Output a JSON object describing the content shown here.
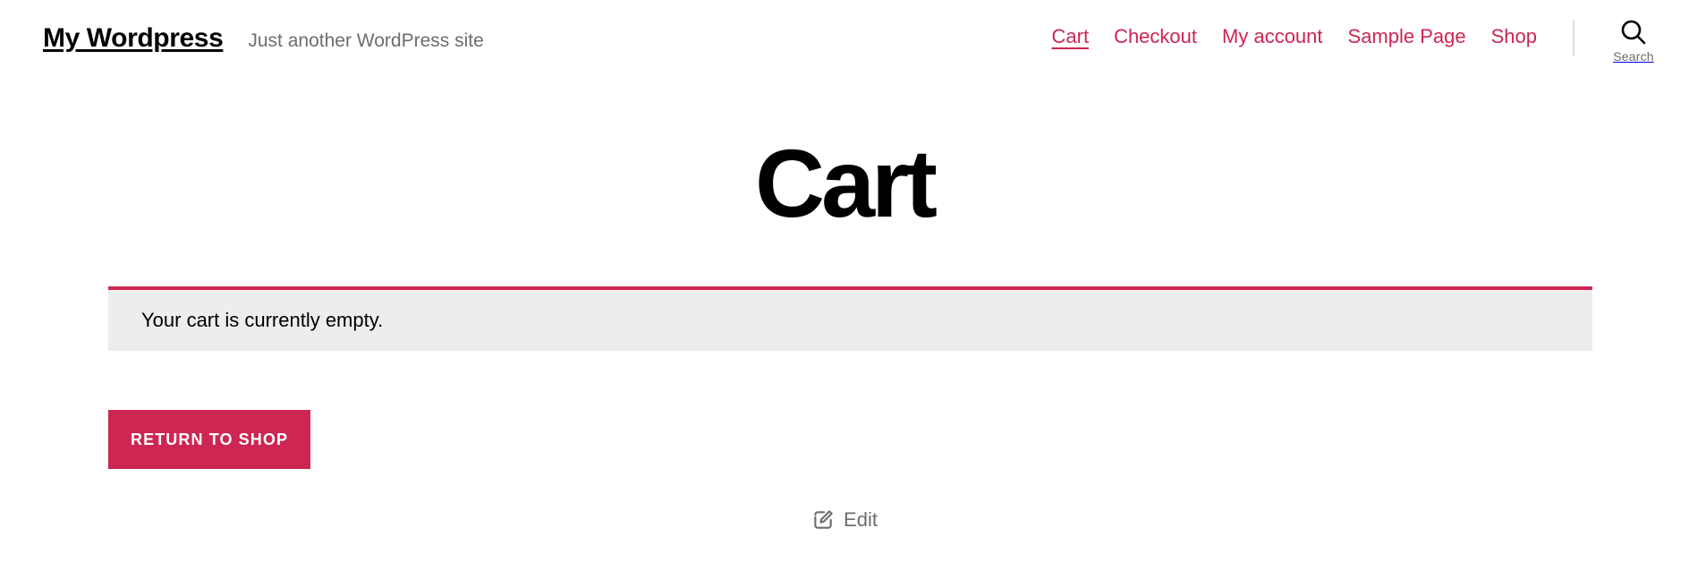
{
  "site": {
    "title": "My Wordpress",
    "tagline": "Just another WordPress site"
  },
  "colors": {
    "accent": "#cd2653",
    "notice_background": "#ededed",
    "text_muted": "#6d6d6d",
    "divider": "#dedddb"
  },
  "nav": {
    "items": [
      {
        "label": "Cart",
        "current": true
      },
      {
        "label": "Checkout",
        "current": false
      },
      {
        "label": "My account",
        "current": false
      },
      {
        "label": "Sample Page",
        "current": false
      },
      {
        "label": "Shop",
        "current": false
      }
    ]
  },
  "search": {
    "icon": "search-icon",
    "label": "Search"
  },
  "main": {
    "page_title": "Cart",
    "notice": "Your cart is currently empty.",
    "return_button": "Return to shop"
  },
  "footer": {
    "edit_icon": "edit-pencil-square-icon",
    "edit_label": "Edit"
  }
}
